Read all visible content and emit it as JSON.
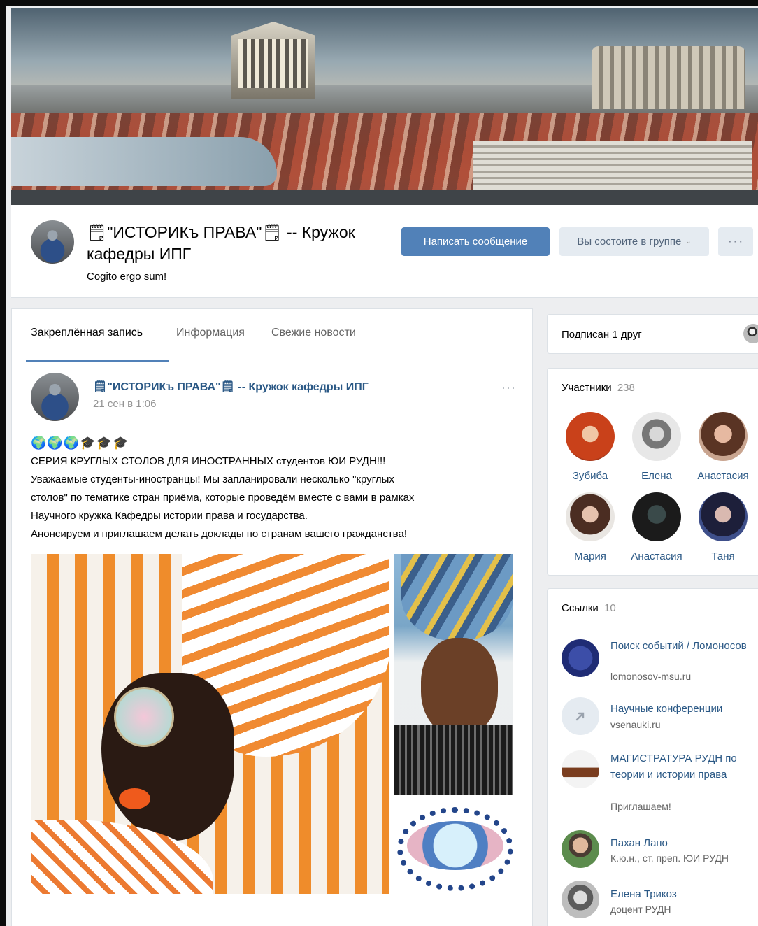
{
  "group": {
    "title": "🗒\"ИСТОРИКъ ПРАВА\"🗒 -- Кружок кафедры ИПГ",
    "status": "Cogito ergo sum!",
    "message_button": "Написать сообщение",
    "member_button": "Вы состоите в группе",
    "more_button": "···"
  },
  "tabs": [
    "Закреплённая запись",
    "Информация",
    "Свежие новости"
  ],
  "post": {
    "author": "🗒\"ИСТОРИКъ ПРАВА\"🗒 -- Кружок кафедры ИПГ",
    "date": "21 сен в 1:06",
    "emoji": "🌍🌍🌍🎓🎓🎓",
    "lines": [
      "СЕРИЯ КРУГЛЫХ СТОЛОВ ДЛЯ ИНОСТРАННЫХ студентов ЮИ РУДН!!!",
      "Уважаемые студенты-иностранцы! Мы запланировали несколько \"круглых",
      "столов\" по тематике стран приёма, которые проведём вместе с вами в рамках",
      "Научного кружка Кафедры истории права и государства.",
      "Анонсируем и приглашаем делать доклады по странам вашего гражданства!"
    ]
  },
  "sidebar": {
    "subscribed": "Подписан 1 друг",
    "members_label": "Участники",
    "members_count": "238",
    "members": [
      "Зубиба",
      "Елена",
      "Анастасия",
      "Мария",
      "Анастасия",
      "Таня"
    ],
    "links_label": "Ссылки",
    "links_count": "10",
    "links": [
      {
        "title": "Поиск событий / Ломоносов",
        "subtitle": "lomonosov-msu.ru"
      },
      {
        "title": "Научные конференции",
        "subtitle": "vsenauki.ru"
      },
      {
        "title": "МАГИСТРАТУРА РУДН по теории и истории права",
        "subtitle": "Приглашаем!"
      },
      {
        "title": "Пахан Лапо",
        "subtitle": "К.ю.н., ст. преп. ЮИ РУДН"
      },
      {
        "title": "Елена Трикоз",
        "subtitle": "доцент РУДН"
      }
    ]
  },
  "colors": {
    "accent": "#5181b8",
    "link": "#2a5885",
    "page_bg": "#edeef0"
  }
}
